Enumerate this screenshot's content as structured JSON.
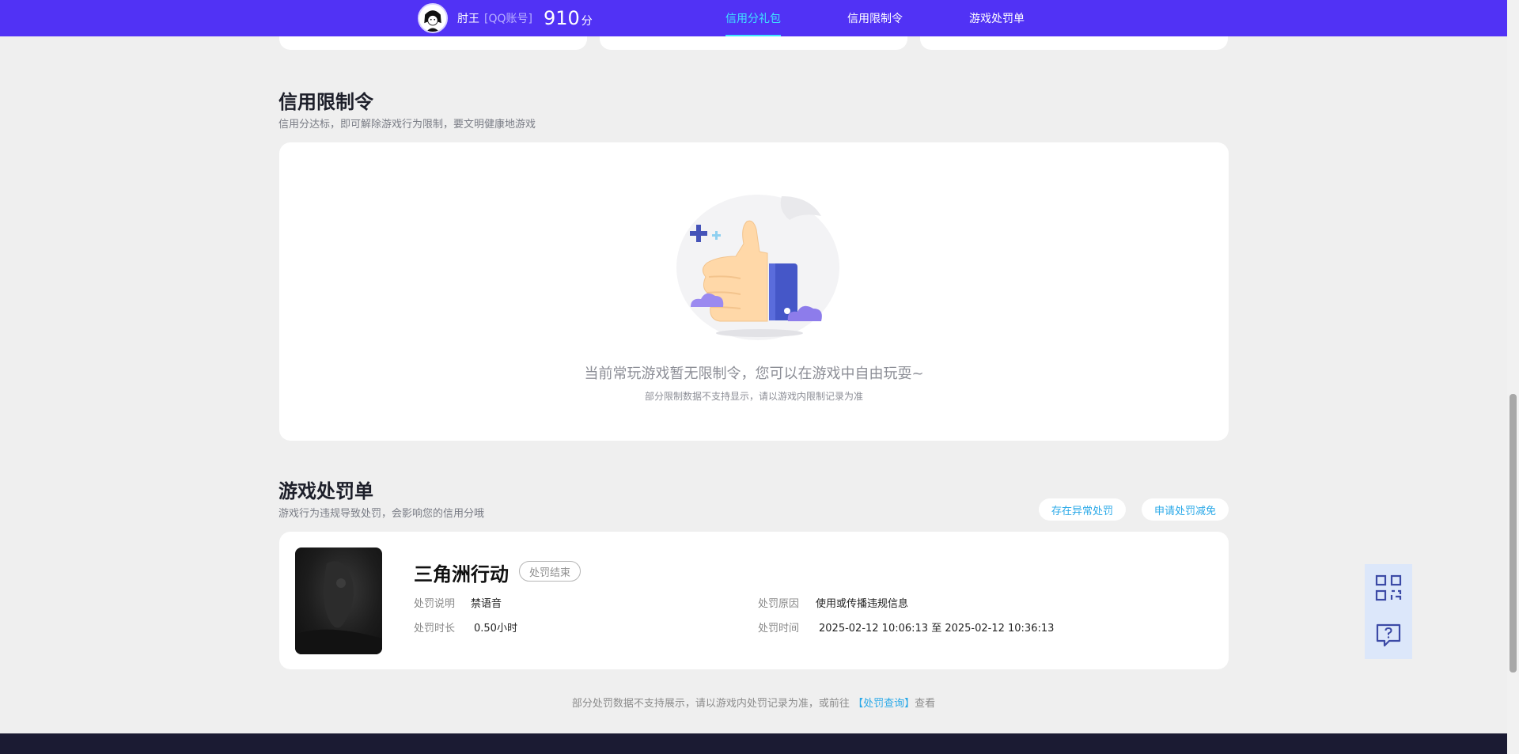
{
  "header": {
    "username": "肘王",
    "account_tag": "[QQ账号]",
    "score": "910",
    "score_unit": "分",
    "nav": [
      {
        "label": "信用分礼包",
        "active": true
      },
      {
        "label": "信用限制令",
        "active": false
      },
      {
        "label": "游戏处罚单",
        "active": false
      }
    ]
  },
  "restriction": {
    "title": "信用限制令",
    "subtitle": "信用分达标，即可解除游戏行为限制，要文明健康地游戏",
    "empty_text": "当前常玩游戏暂无限制令，您可以在游戏中自由玩耍~",
    "empty_note": "部分限制数据不支持显示，请以游戏内限制记录为准"
  },
  "penalty": {
    "title": "游戏处罚单",
    "subtitle": "游戏行为违规导致处罚，会影响您的信用分哦",
    "btn_abnormal": "存在异常处罚",
    "btn_appeal": "申请处罚减免",
    "items": [
      {
        "game": "三角洲行动",
        "status": "处罚结束",
        "desc_label": "处罚说明",
        "desc_value": "禁语音",
        "duration_label": "处罚时长",
        "duration_value": "0.50小时",
        "reason_label": "处罚原因",
        "reason_value": "使用或传播违规信息",
        "time_label": "处罚时间",
        "time_value": "2025-02-12 10:06:13 至 2025-02-12 10:36:13"
      }
    ],
    "footnote_prefix": "部分处罚数据不支持展示，请以游戏内处罚记录为准，或前往",
    "footnote_link": "【处罚查询】",
    "footnote_suffix": "查看"
  },
  "float_buttons": {
    "qr_icon": "qrcode-icon",
    "feedback_icon": "question-chat-icon"
  },
  "colors": {
    "brand": "#5132f5",
    "nav_active": "#3ee4ff",
    "link": "#2aa9e8"
  }
}
